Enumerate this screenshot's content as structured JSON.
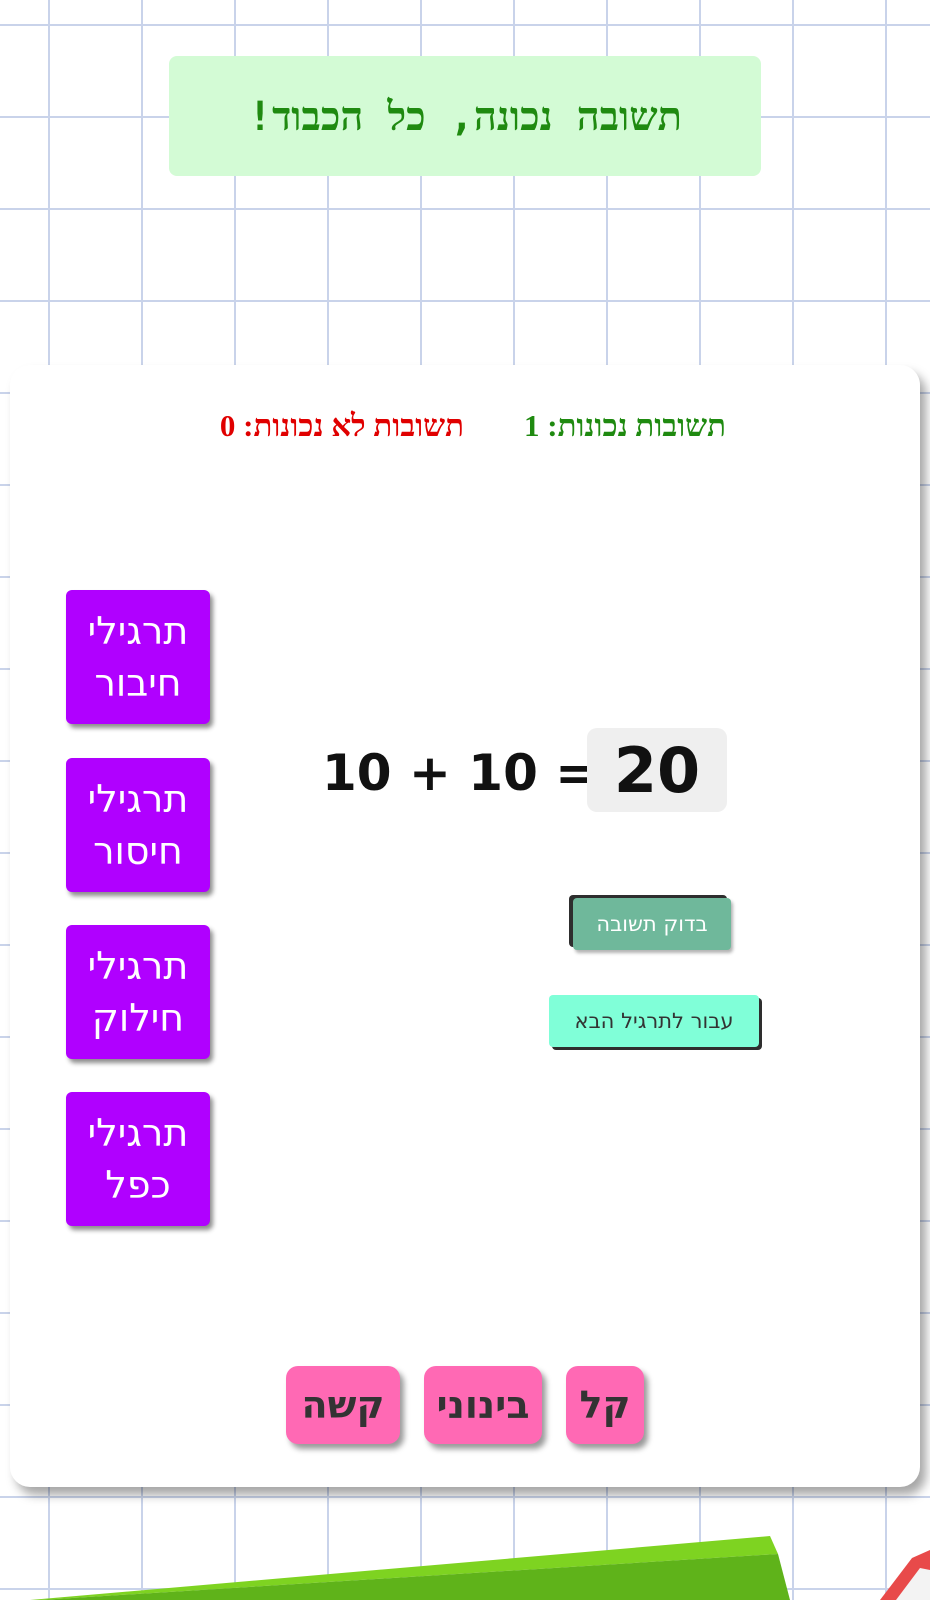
{
  "feedback": {
    "message": "תשובה נכונה, כל הכבוד!"
  },
  "score": {
    "correct_label": "תשובות נכונות: 1",
    "wrong_label": "תשובות לא נכונות: 0",
    "correct_color": "#1f8a10",
    "wrong_color": "#e00000"
  },
  "exercise_menu": {
    "items": [
      {
        "label": "תרגילי\nחיבור"
      },
      {
        "label": "תרגילי\nחיסור"
      },
      {
        "label": "תרגילי\nחילוק"
      },
      {
        "label": "תרגילי\nכפל"
      }
    ],
    "color": "#b000ff"
  },
  "exercise": {
    "equation": "10 + 10 =",
    "answer_value": "20"
  },
  "actions": {
    "check_label": "בדוק תשובה",
    "next_label": "עבור לתרגיל הבא"
  },
  "levels": {
    "items": [
      {
        "label": "קל"
      },
      {
        "label": "בינוני"
      },
      {
        "label": "קשה"
      }
    ],
    "color": "#ff69b4"
  }
}
